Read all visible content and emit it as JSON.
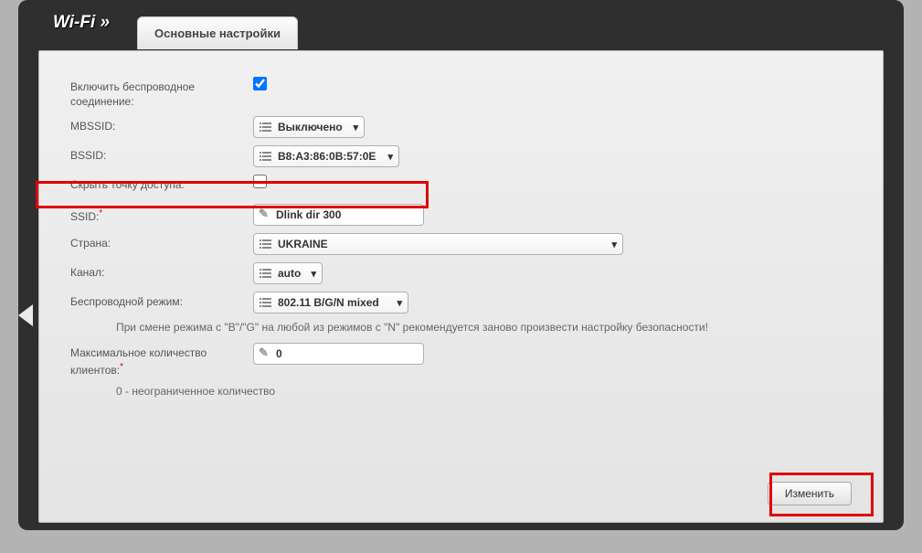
{
  "header": {
    "title": "Wi-Fi »"
  },
  "tab": {
    "label": "Основные настройки"
  },
  "form": {
    "enable_label": "Включить беспроводное соединение:",
    "enable_checked": true,
    "mbssid_label": "MBSSID:",
    "mbssid_value": "Выключено",
    "bssid_label": "BSSID:",
    "bssid_value": "B8:A3:86:0B:57:0E",
    "hide_ap_label": "Скрыть точку доступа:",
    "hide_ap_checked": false,
    "ssid_label": "SSID:",
    "ssid_value": "Dlink dir 300",
    "country_label": "Страна:",
    "country_value": "UKRAINE",
    "channel_label": "Канал:",
    "channel_value": "auto",
    "mode_label": "Беспроводной режим:",
    "mode_value": "802.11 B/G/N mixed",
    "mode_note": "При смене режима с \"B\"/\"G\" на любой из режимов с \"N\" рекомендуется заново произвести настройку безопасности!",
    "max_clients_label": "Максимальное количество клиентов:",
    "max_clients_value": "0",
    "max_clients_note": "0 - неограниченное количество"
  },
  "buttons": {
    "apply": "Изменить"
  }
}
